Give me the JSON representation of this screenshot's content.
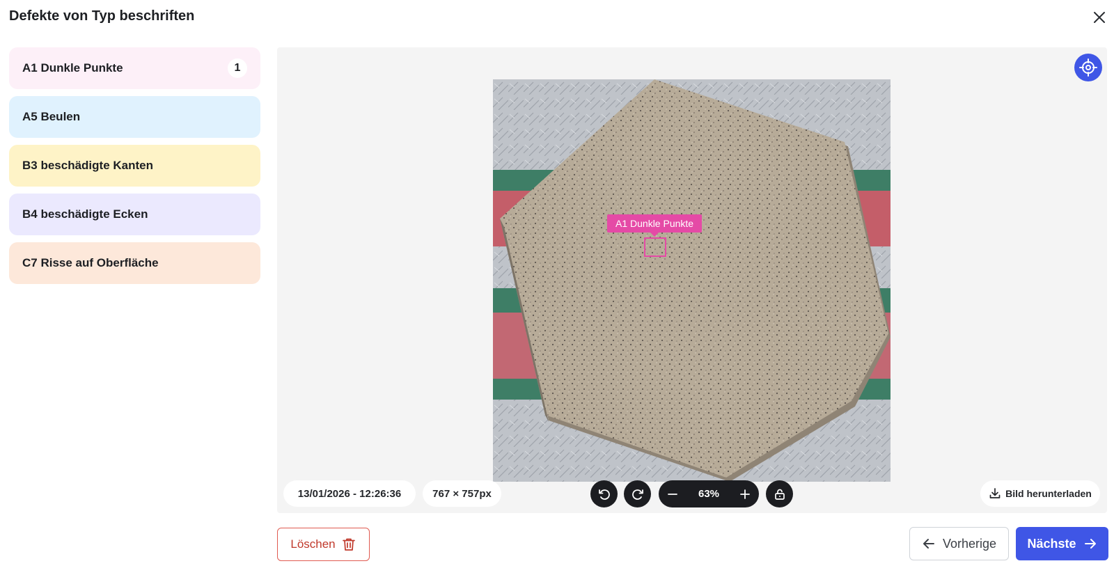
{
  "modal": {
    "title": "Defekte von Typ beschriften"
  },
  "defects": [
    {
      "label": "A1 Dunkle Punkte",
      "count": "1",
      "color": "#fdf0f8"
    },
    {
      "label": "A5 Beulen",
      "count": "",
      "color": "#e0f2fe"
    },
    {
      "label": "B3 beschädigte Kanten",
      "count": "",
      "color": "#fef3c7"
    },
    {
      "label": "B4 beschädigte Ecken",
      "count": "",
      "color": "#ebe9fe"
    },
    {
      "label": "C7 Risse auf Oberfläche",
      "count": "",
      "color": "#fde8da"
    }
  ],
  "viewer": {
    "annotation_label": "A1 Dunkle Punkte",
    "annotation_color": "#e54aa6",
    "timestamp": "13/01/2026 - 12:26:36",
    "dimensions": "767 × 757px",
    "zoom": "63%",
    "download_label": "Bild herunterladen"
  },
  "footer": {
    "delete_label": "Löschen",
    "prev_label": "Vorherige",
    "next_label": "Nächste"
  },
  "colors": {
    "accent": "#3f56e6",
    "danger": "#c0392b",
    "dark_control": "#1c1d21"
  }
}
